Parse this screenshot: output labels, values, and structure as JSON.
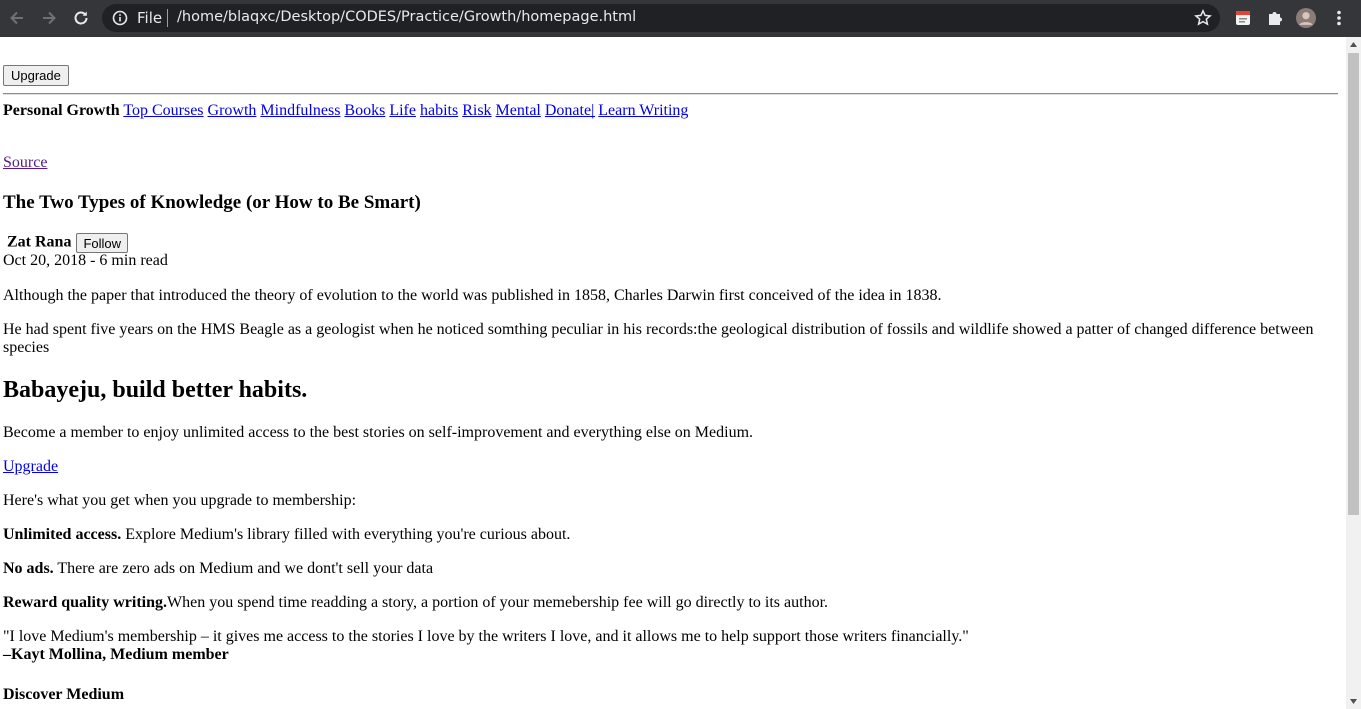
{
  "browser": {
    "scheme_label": "File",
    "url": "/home/blaqxc/Desktop/CODES/Practice/Growth/homepage.html"
  },
  "page": {
    "upgrade_button": "Upgrade",
    "nav": {
      "brand": "Personal Growth",
      "links": [
        "Top Courses",
        "Growth",
        "Mindfulness",
        "Books",
        "Life",
        "habits",
        "Risk",
        "Mental",
        "Donate ",
        "|",
        "Learn Writing"
      ]
    },
    "source_link": "Source",
    "article": {
      "title": "The Two Types of Knowledge (or How to Be Smart)",
      "author": "Zat Rana",
      "follow_button": "Follow",
      "meta": "Oct 20, 2018 - 6 min read",
      "p1": "Although the paper that introduced the theory of evolution to the world was published in 1858, Charles Darwin first conceived of the idea in 1838.",
      "p2": "He had spent five years on the HMS Beagle as a geologist when he noticed somthing peculiar in his records:the geological distribution of fossils and wildlife showed a patter of changed difference between species"
    },
    "promo": {
      "heading": "Babayeju, build better habits.",
      "intro": "Become a member to enjoy unlimited access to the best stories on self-improvement and everything else on Medium.",
      "upgrade_link": "Upgrade",
      "what_you_get": "Here's what you get when you upgrade to membership:",
      "b1_bold": "Unlimited access.",
      "b1_text": " Explore Medium's library filled with everything you're curious about.",
      "b2_bold": "No ads.",
      "b2_text": " There are zero ads on Medium and we dont't sell your data",
      "b3_bold": "Reward quality writing.",
      "b3_text": "When you spend time readding a story, a portion of your memebership fee will go directly to its author.",
      "quote": "\"I love Medium's membership – it gives me access to the stories I love by the writers I love, and it allows me to help support those writers financially.\"",
      "quote_author": "–Kayt Mollina, Medium member",
      "discover": "Discover Medium"
    }
  }
}
